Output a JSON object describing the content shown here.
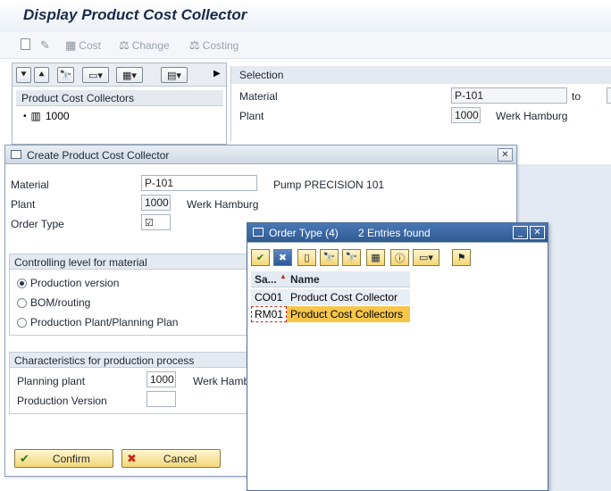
{
  "window": {
    "title": "Display Product Cost Collector"
  },
  "toolbar": {
    "cost_label": "Cost",
    "change_label": "Change",
    "costing_label": "Costing"
  },
  "tree": {
    "header": "Product Cost Collectors",
    "items": [
      {
        "label": "1000"
      }
    ]
  },
  "selection": {
    "header": "Selection",
    "material_label": "Material",
    "material_value": "P-101",
    "to_label": "to",
    "plant_label": "Plant",
    "plant_value": "1000",
    "plant_name": "Werk Hamburg"
  },
  "create_dialog": {
    "title": "Create Product Cost Collector",
    "material_label": "Material",
    "material_value": "P-101",
    "material_desc": "Pump PRECISION 101",
    "plant_label": "Plant",
    "plant_value": "1000",
    "plant_name": "Werk Hamburg",
    "order_type_label": "Order Type",
    "order_type_value": "",
    "controlling_group": {
      "title": "Controlling level for material",
      "options": [
        {
          "label": "Production version",
          "selected": true
        },
        {
          "label": "BOM/routing",
          "selected": false
        },
        {
          "label": "Production Plant/Planning Plan",
          "selected": false
        }
      ]
    },
    "characteristics_group": {
      "title": "Characteristics for production process",
      "planning_plant_label": "Planning plant",
      "planning_plant_value": "1000",
      "planning_plant_name": "Werk Hamb",
      "production_version_label": "Production Version",
      "production_version_value": ""
    },
    "confirm_label": "Confirm",
    "cancel_label": "Cancel"
  },
  "order_type_dialog": {
    "title": "Order Type (4)",
    "entries_found": "2 Entries found",
    "columns": {
      "sa": "Sa...",
      "name": "Name"
    },
    "rows": [
      {
        "code": "CO01",
        "name": "Product Cost Collector",
        "highlighted": false
      },
      {
        "code": "RM01",
        "name": "Product Cost Collectors",
        "highlighted": true
      }
    ]
  },
  "colors": {
    "title_text": "#1a2a4a",
    "dialog_title_blue": "#3a67a3",
    "highlight_row": "#f7c648",
    "button_yellow": "#f5d77a"
  }
}
